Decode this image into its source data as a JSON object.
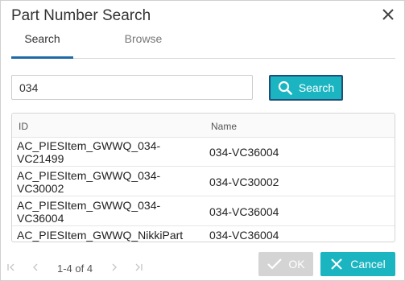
{
  "dialog": {
    "title": "Part Number Search"
  },
  "tabs": [
    {
      "label": "Search",
      "active": true
    },
    {
      "label": "Browse",
      "active": false
    }
  ],
  "search": {
    "value": "034",
    "button_label": "Search"
  },
  "grid": {
    "columns": [
      "ID",
      "Name"
    ],
    "rows": [
      {
        "id": "AC_PIESItem_GWWQ_034-VC21499",
        "name": "034-VC36004"
      },
      {
        "id": "AC_PIESItem_GWWQ_034-VC30002",
        "name": "034-VC30002"
      },
      {
        "id": "AC_PIESItem_GWWQ_034-VC36004",
        "name": "034-VC36004"
      },
      {
        "id": "AC_PIESItem_GWWQ_NikkiPart",
        "name": "034-VC36004"
      }
    ]
  },
  "pager": {
    "range_text": "1-4 of 4"
  },
  "footer": {
    "ok_label": "OK",
    "cancel_label": "Cancel"
  },
  "colors": {
    "accent": "#1ab5c1",
    "tab_underline": "#1e6aa7",
    "disabled": "#d4d4d4"
  },
  "icons": {
    "close": "close-icon",
    "search": "search-icon",
    "ok": "check-icon",
    "cancel": "x-icon"
  }
}
